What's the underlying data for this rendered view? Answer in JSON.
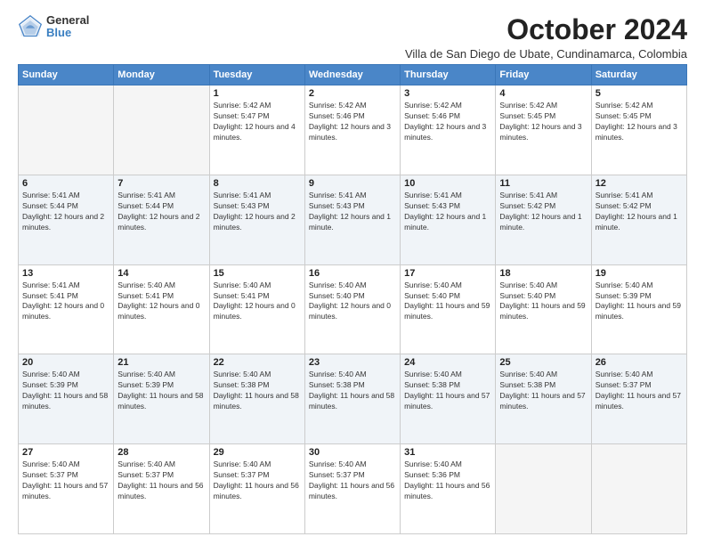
{
  "logo": {
    "general": "General",
    "blue": "Blue"
  },
  "title": "October 2024",
  "subtitle": "Villa de San Diego de Ubate, Cundinamarca, Colombia",
  "days_of_week": [
    "Sunday",
    "Monday",
    "Tuesday",
    "Wednesday",
    "Thursday",
    "Friday",
    "Saturday"
  ],
  "weeks": [
    [
      {
        "day": "",
        "empty": true
      },
      {
        "day": "",
        "empty": true
      },
      {
        "day": "1",
        "sunrise": "Sunrise: 5:42 AM",
        "sunset": "Sunset: 5:47 PM",
        "daylight": "Daylight: 12 hours and 4 minutes."
      },
      {
        "day": "2",
        "sunrise": "Sunrise: 5:42 AM",
        "sunset": "Sunset: 5:46 PM",
        "daylight": "Daylight: 12 hours and 3 minutes."
      },
      {
        "day": "3",
        "sunrise": "Sunrise: 5:42 AM",
        "sunset": "Sunset: 5:46 PM",
        "daylight": "Daylight: 12 hours and 3 minutes."
      },
      {
        "day": "4",
        "sunrise": "Sunrise: 5:42 AM",
        "sunset": "Sunset: 5:45 PM",
        "daylight": "Daylight: 12 hours and 3 minutes."
      },
      {
        "day": "5",
        "sunrise": "Sunrise: 5:42 AM",
        "sunset": "Sunset: 5:45 PM",
        "daylight": "Daylight: 12 hours and 3 minutes."
      }
    ],
    [
      {
        "day": "6",
        "sunrise": "Sunrise: 5:41 AM",
        "sunset": "Sunset: 5:44 PM",
        "daylight": "Daylight: 12 hours and 2 minutes."
      },
      {
        "day": "7",
        "sunrise": "Sunrise: 5:41 AM",
        "sunset": "Sunset: 5:44 PM",
        "daylight": "Daylight: 12 hours and 2 minutes."
      },
      {
        "day": "8",
        "sunrise": "Sunrise: 5:41 AM",
        "sunset": "Sunset: 5:43 PM",
        "daylight": "Daylight: 12 hours and 2 minutes."
      },
      {
        "day": "9",
        "sunrise": "Sunrise: 5:41 AM",
        "sunset": "Sunset: 5:43 PM",
        "daylight": "Daylight: 12 hours and 1 minute."
      },
      {
        "day": "10",
        "sunrise": "Sunrise: 5:41 AM",
        "sunset": "Sunset: 5:43 PM",
        "daylight": "Daylight: 12 hours and 1 minute."
      },
      {
        "day": "11",
        "sunrise": "Sunrise: 5:41 AM",
        "sunset": "Sunset: 5:42 PM",
        "daylight": "Daylight: 12 hours and 1 minute."
      },
      {
        "day": "12",
        "sunrise": "Sunrise: 5:41 AM",
        "sunset": "Sunset: 5:42 PM",
        "daylight": "Daylight: 12 hours and 1 minute."
      }
    ],
    [
      {
        "day": "13",
        "sunrise": "Sunrise: 5:41 AM",
        "sunset": "Sunset: 5:41 PM",
        "daylight": "Daylight: 12 hours and 0 minutes."
      },
      {
        "day": "14",
        "sunrise": "Sunrise: 5:40 AM",
        "sunset": "Sunset: 5:41 PM",
        "daylight": "Daylight: 12 hours and 0 minutes."
      },
      {
        "day": "15",
        "sunrise": "Sunrise: 5:40 AM",
        "sunset": "Sunset: 5:41 PM",
        "daylight": "Daylight: 12 hours and 0 minutes."
      },
      {
        "day": "16",
        "sunrise": "Sunrise: 5:40 AM",
        "sunset": "Sunset: 5:40 PM",
        "daylight": "Daylight: 12 hours and 0 minutes."
      },
      {
        "day": "17",
        "sunrise": "Sunrise: 5:40 AM",
        "sunset": "Sunset: 5:40 PM",
        "daylight": "Daylight: 11 hours and 59 minutes."
      },
      {
        "day": "18",
        "sunrise": "Sunrise: 5:40 AM",
        "sunset": "Sunset: 5:40 PM",
        "daylight": "Daylight: 11 hours and 59 minutes."
      },
      {
        "day": "19",
        "sunrise": "Sunrise: 5:40 AM",
        "sunset": "Sunset: 5:39 PM",
        "daylight": "Daylight: 11 hours and 59 minutes."
      }
    ],
    [
      {
        "day": "20",
        "sunrise": "Sunrise: 5:40 AM",
        "sunset": "Sunset: 5:39 PM",
        "daylight": "Daylight: 11 hours and 58 minutes."
      },
      {
        "day": "21",
        "sunrise": "Sunrise: 5:40 AM",
        "sunset": "Sunset: 5:39 PM",
        "daylight": "Daylight: 11 hours and 58 minutes."
      },
      {
        "day": "22",
        "sunrise": "Sunrise: 5:40 AM",
        "sunset": "Sunset: 5:38 PM",
        "daylight": "Daylight: 11 hours and 58 minutes."
      },
      {
        "day": "23",
        "sunrise": "Sunrise: 5:40 AM",
        "sunset": "Sunset: 5:38 PM",
        "daylight": "Daylight: 11 hours and 58 minutes."
      },
      {
        "day": "24",
        "sunrise": "Sunrise: 5:40 AM",
        "sunset": "Sunset: 5:38 PM",
        "daylight": "Daylight: 11 hours and 57 minutes."
      },
      {
        "day": "25",
        "sunrise": "Sunrise: 5:40 AM",
        "sunset": "Sunset: 5:38 PM",
        "daylight": "Daylight: 11 hours and 57 minutes."
      },
      {
        "day": "26",
        "sunrise": "Sunrise: 5:40 AM",
        "sunset": "Sunset: 5:37 PM",
        "daylight": "Daylight: 11 hours and 57 minutes."
      }
    ],
    [
      {
        "day": "27",
        "sunrise": "Sunrise: 5:40 AM",
        "sunset": "Sunset: 5:37 PM",
        "daylight": "Daylight: 11 hours and 57 minutes."
      },
      {
        "day": "28",
        "sunrise": "Sunrise: 5:40 AM",
        "sunset": "Sunset: 5:37 PM",
        "daylight": "Daylight: 11 hours and 56 minutes."
      },
      {
        "day": "29",
        "sunrise": "Sunrise: 5:40 AM",
        "sunset": "Sunset: 5:37 PM",
        "daylight": "Daylight: 11 hours and 56 minutes."
      },
      {
        "day": "30",
        "sunrise": "Sunrise: 5:40 AM",
        "sunset": "Sunset: 5:37 PM",
        "daylight": "Daylight: 11 hours and 56 minutes."
      },
      {
        "day": "31",
        "sunrise": "Sunrise: 5:40 AM",
        "sunset": "Sunset: 5:36 PM",
        "daylight": "Daylight: 11 hours and 56 minutes."
      },
      {
        "day": "",
        "empty": true
      },
      {
        "day": "",
        "empty": true
      }
    ]
  ]
}
